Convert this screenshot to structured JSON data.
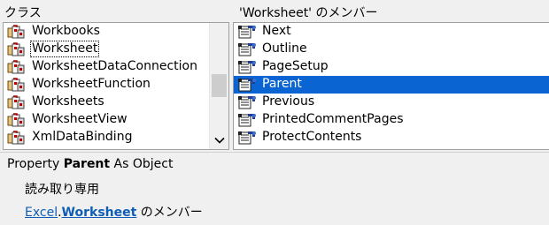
{
  "classes_pane": {
    "label": "クラス",
    "items": [
      {
        "label": "Workbooks"
      },
      {
        "label": "Worksheet",
        "focused": true
      },
      {
        "label": "WorksheetDataConnection"
      },
      {
        "label": "WorksheetFunction"
      },
      {
        "label": "Worksheets"
      },
      {
        "label": "WorksheetView"
      },
      {
        "label": "XmlDataBinding"
      }
    ],
    "scroll_arrow_icon": "chevron-down-icon"
  },
  "members_pane": {
    "label": "'Worksheet' のメンバー",
    "items": [
      {
        "label": "Next"
      },
      {
        "label": "Outline"
      },
      {
        "label": "PageSetup"
      },
      {
        "label": "Parent",
        "selected": true
      },
      {
        "label": "Previous"
      },
      {
        "label": "PrintedCommentPages"
      },
      {
        "label": "ProtectContents"
      }
    ]
  },
  "details": {
    "kind": "Property",
    "member_name": "Parent",
    "as_type": "As Object",
    "readonly_text": "読み取り専用",
    "library_link": "Excel",
    "separator": ".",
    "class_link": "Worksheet",
    "member_of_suffix": " のメンバー"
  },
  "colors": {
    "selection": "#0a64d2",
    "link": "#0f5db5"
  },
  "icons": {
    "class": "class-module-icon",
    "property": "property-icon"
  }
}
